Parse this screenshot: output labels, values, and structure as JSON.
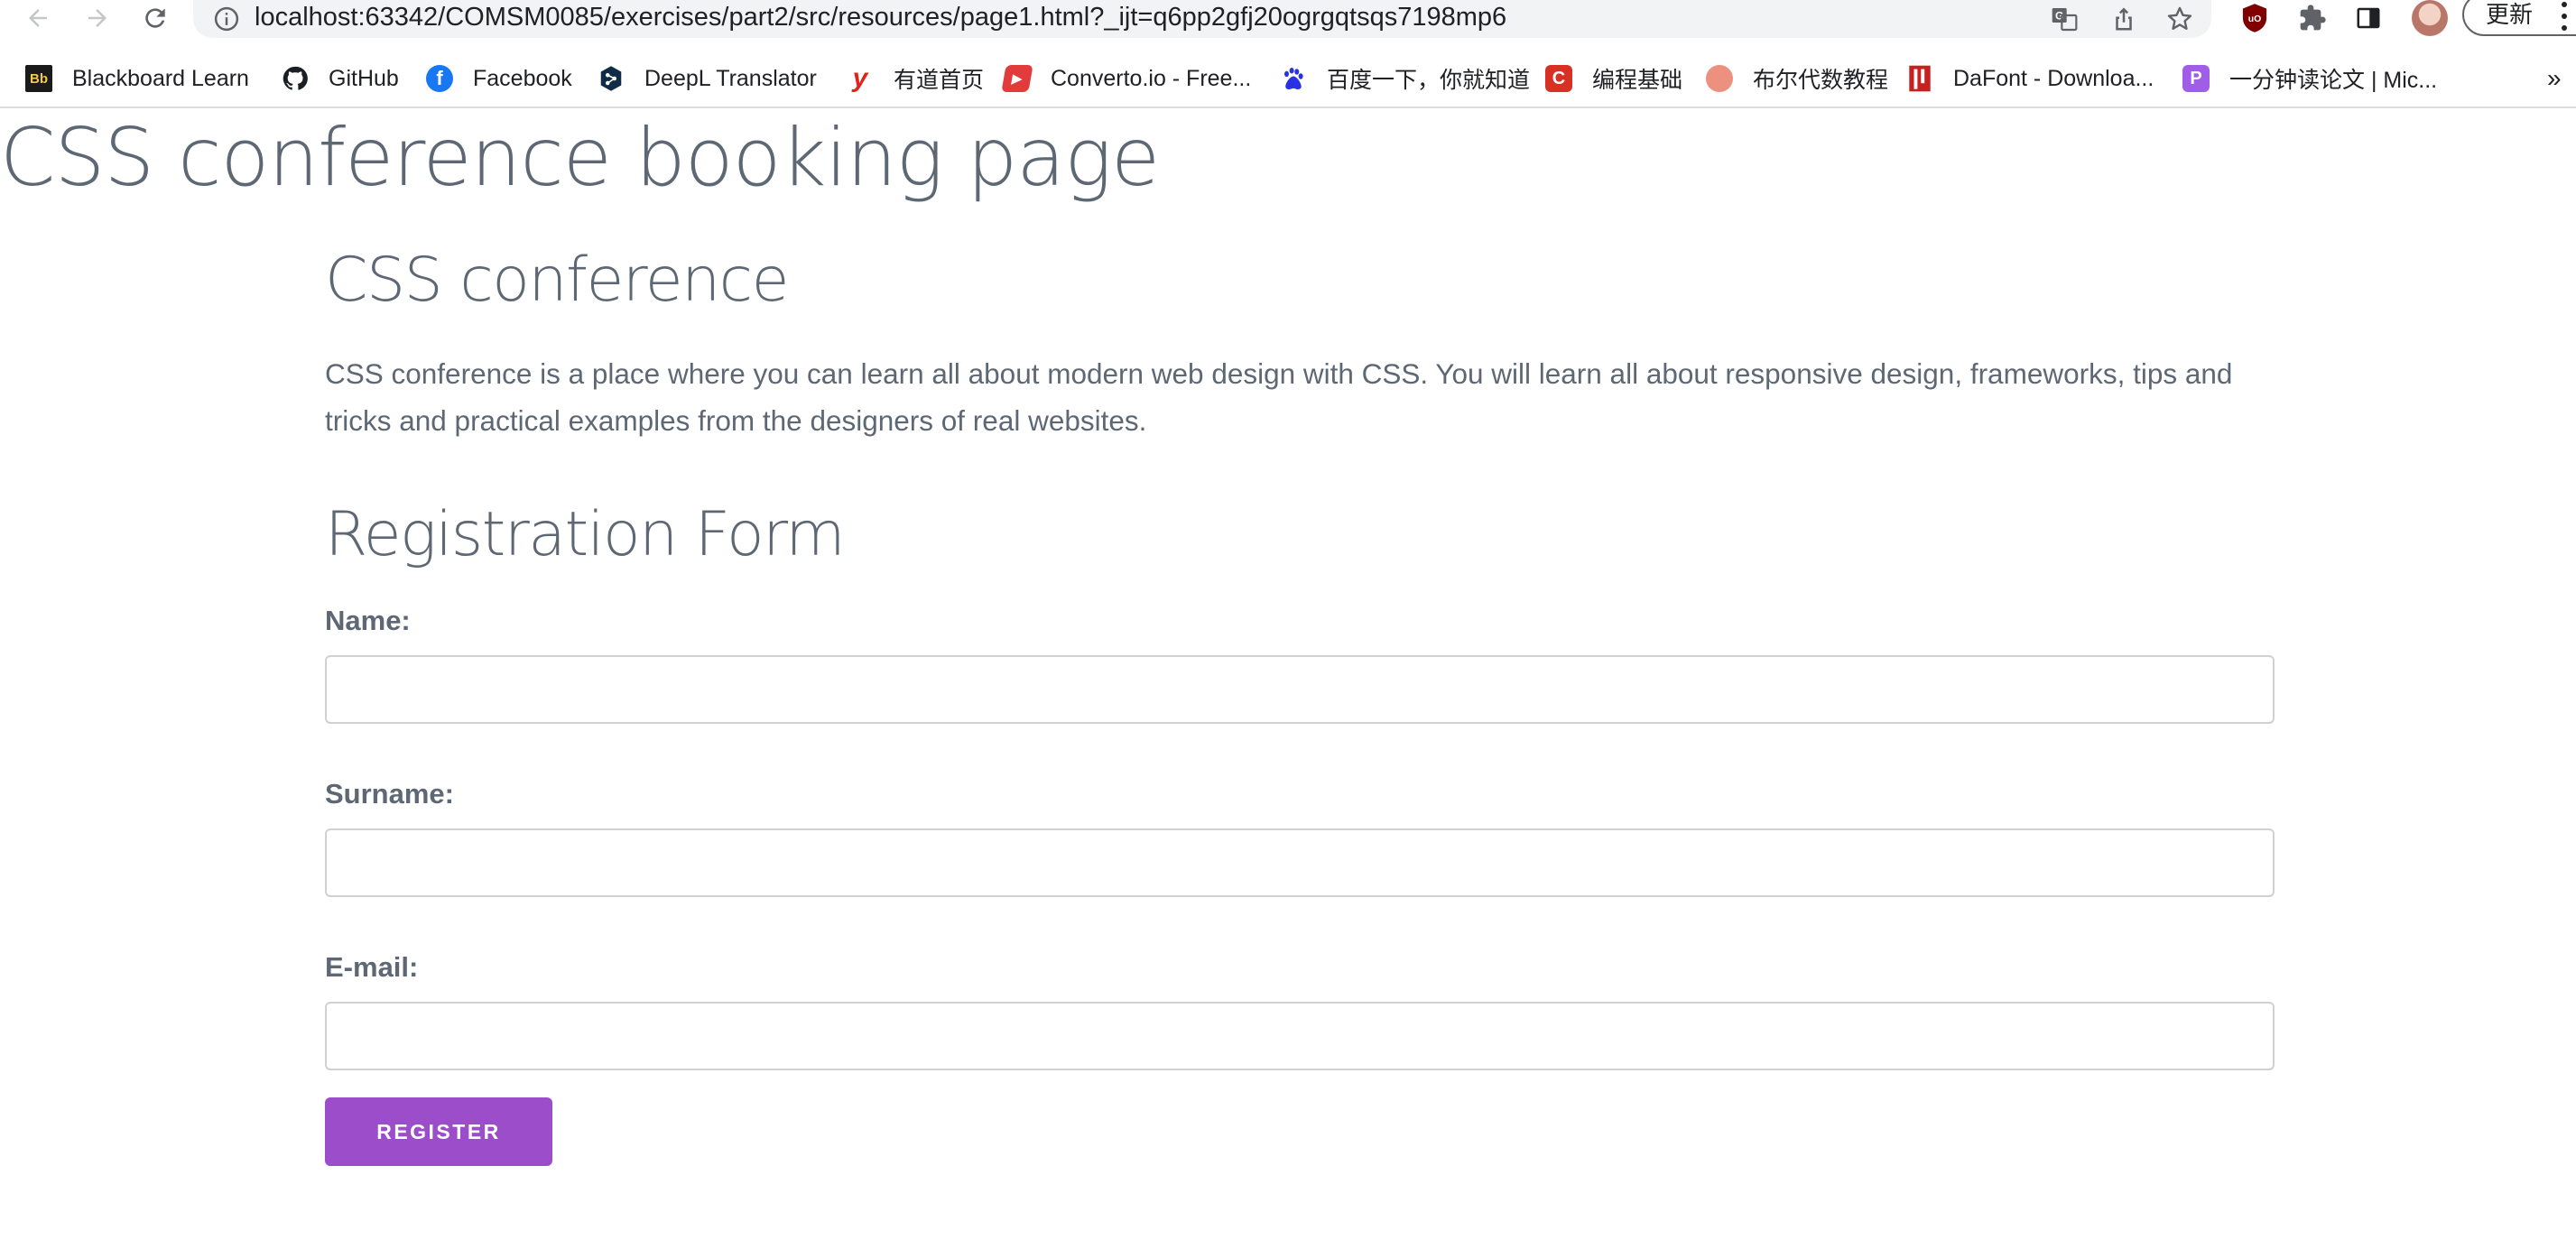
{
  "browser": {
    "url": "localhost:63342/COMSM0085/exercises/part2/src/resources/page1.html?_ijt=q6pp2gfj20ogrgqtsqs7198mp6",
    "update_label": "更新",
    "more_bookmarks": "»",
    "bookmarks": [
      {
        "label": "Blackboard Learn",
        "icon": "bb-icon",
        "color": "#1a1a1a",
        "glyph": "Bb"
      },
      {
        "label": "GitHub",
        "icon": "github-icon",
        "color": "#1b1f23",
        "glyph": ""
      },
      {
        "label": "Facebook",
        "icon": "facebook-icon",
        "color": "#1877f2",
        "glyph": "f"
      },
      {
        "label": "DeepL Translator",
        "icon": "deepl-icon",
        "color": "#0f2b46",
        "glyph": ""
      },
      {
        "label": "有道首页",
        "icon": "youdao-icon",
        "color": "#e0241b",
        "glyph": "y"
      },
      {
        "label": "Converto.io - Free...",
        "icon": "converto-icon",
        "color": "#e23b3b",
        "glyph": "▶"
      },
      {
        "label": "百度一下，你就知道",
        "icon": "baidu-icon",
        "color": "#2932e1",
        "glyph": ""
      },
      {
        "label": "编程基础",
        "icon": "c-icon",
        "color": "#d93025",
        "glyph": "C"
      },
      {
        "label": "布尔代数教程",
        "icon": "circle-icon",
        "color": "#ec9080",
        "glyph": ""
      },
      {
        "label": "DaFont - Downloa...",
        "icon": "dafont-icon",
        "color": "#c5221f",
        "glyph": ""
      },
      {
        "label": "一分钟读论文 | Mic...",
        "icon": "p-icon",
        "color": "#a05de8",
        "glyph": "P"
      }
    ]
  },
  "page": {
    "title": "CSS conference booking page",
    "conference_title": "CSS conference",
    "intro": "CSS conference is a place where you can learn all about modern web design with CSS. You will learn all about responsive design, frameworks, tips and tricks and practical examples from the designers of real websites.",
    "form_title": "Registration Form",
    "fields": {
      "name_label": "Name:",
      "name_value": "",
      "surname_label": "Surname:",
      "surname_value": "",
      "email_label": "E-mail:",
      "email_value": ""
    },
    "register_label": "REGISTER"
  },
  "colors": {
    "accent": "#9b4dca",
    "text": "#5e6875",
    "input_border": "#d1d1d1"
  }
}
